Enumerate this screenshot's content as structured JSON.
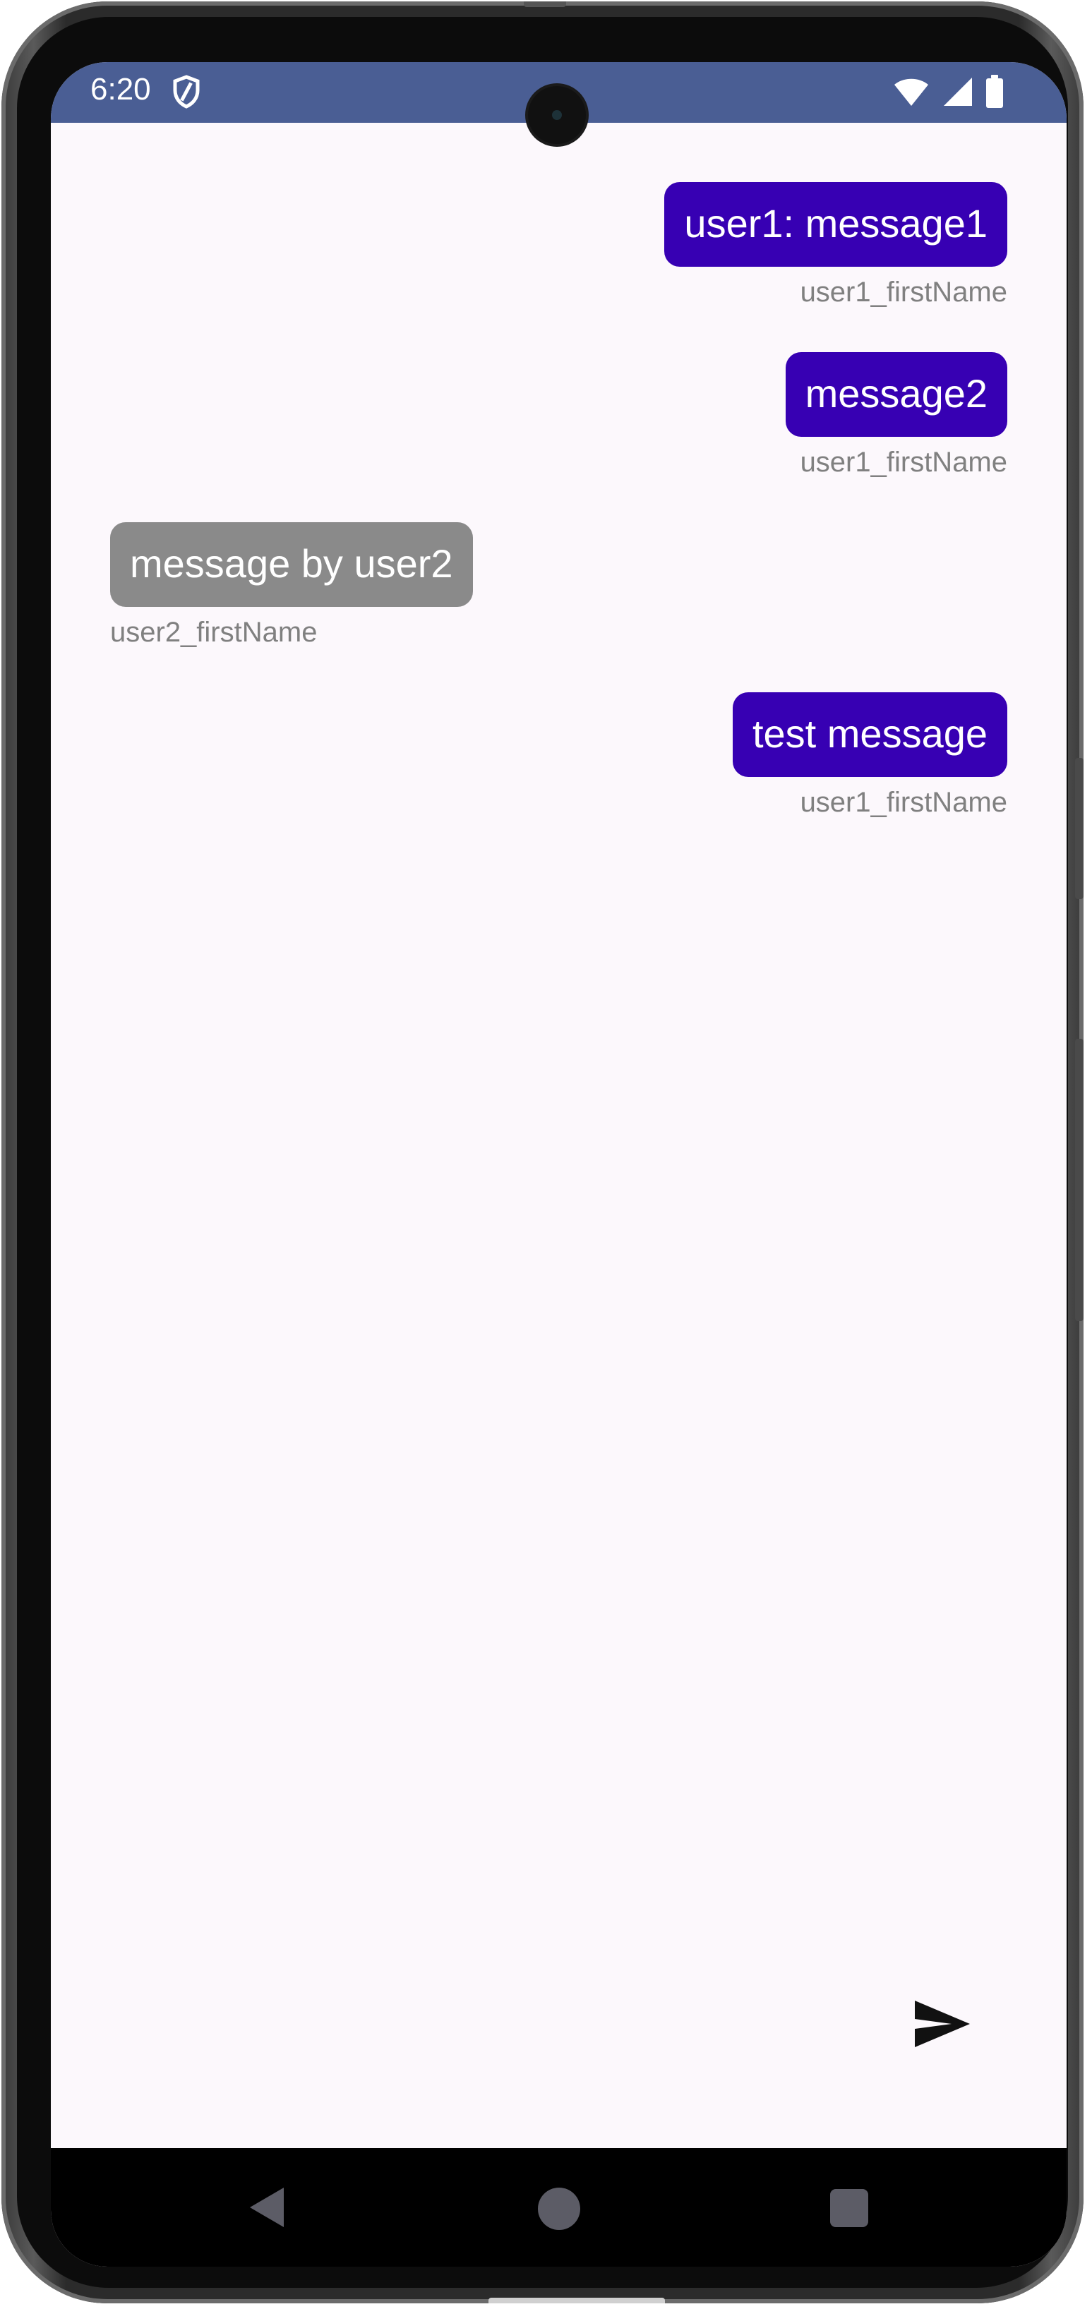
{
  "status_bar": {
    "time": "6:20",
    "color": "#4a5e94"
  },
  "messages": [
    {
      "text": "user1: message1",
      "sender": "user1_firstName",
      "side": "right"
    },
    {
      "text": "message2",
      "sender": "user1_firstName",
      "side": "right"
    },
    {
      "text": "message by user2",
      "sender": "user2_firstName",
      "side": "left"
    },
    {
      "text": "test message",
      "sender": "user1_firstName",
      "side": "right"
    }
  ],
  "colors": {
    "own_bubble": "#3700b3",
    "other_bubble": "#8a8a8a",
    "sender_text": "#808080",
    "background": "#fcf8fc"
  },
  "icons": {
    "send": "send-icon",
    "back": "back-triangle-icon",
    "home": "home-circle-icon",
    "recent": "recent-square-icon"
  }
}
